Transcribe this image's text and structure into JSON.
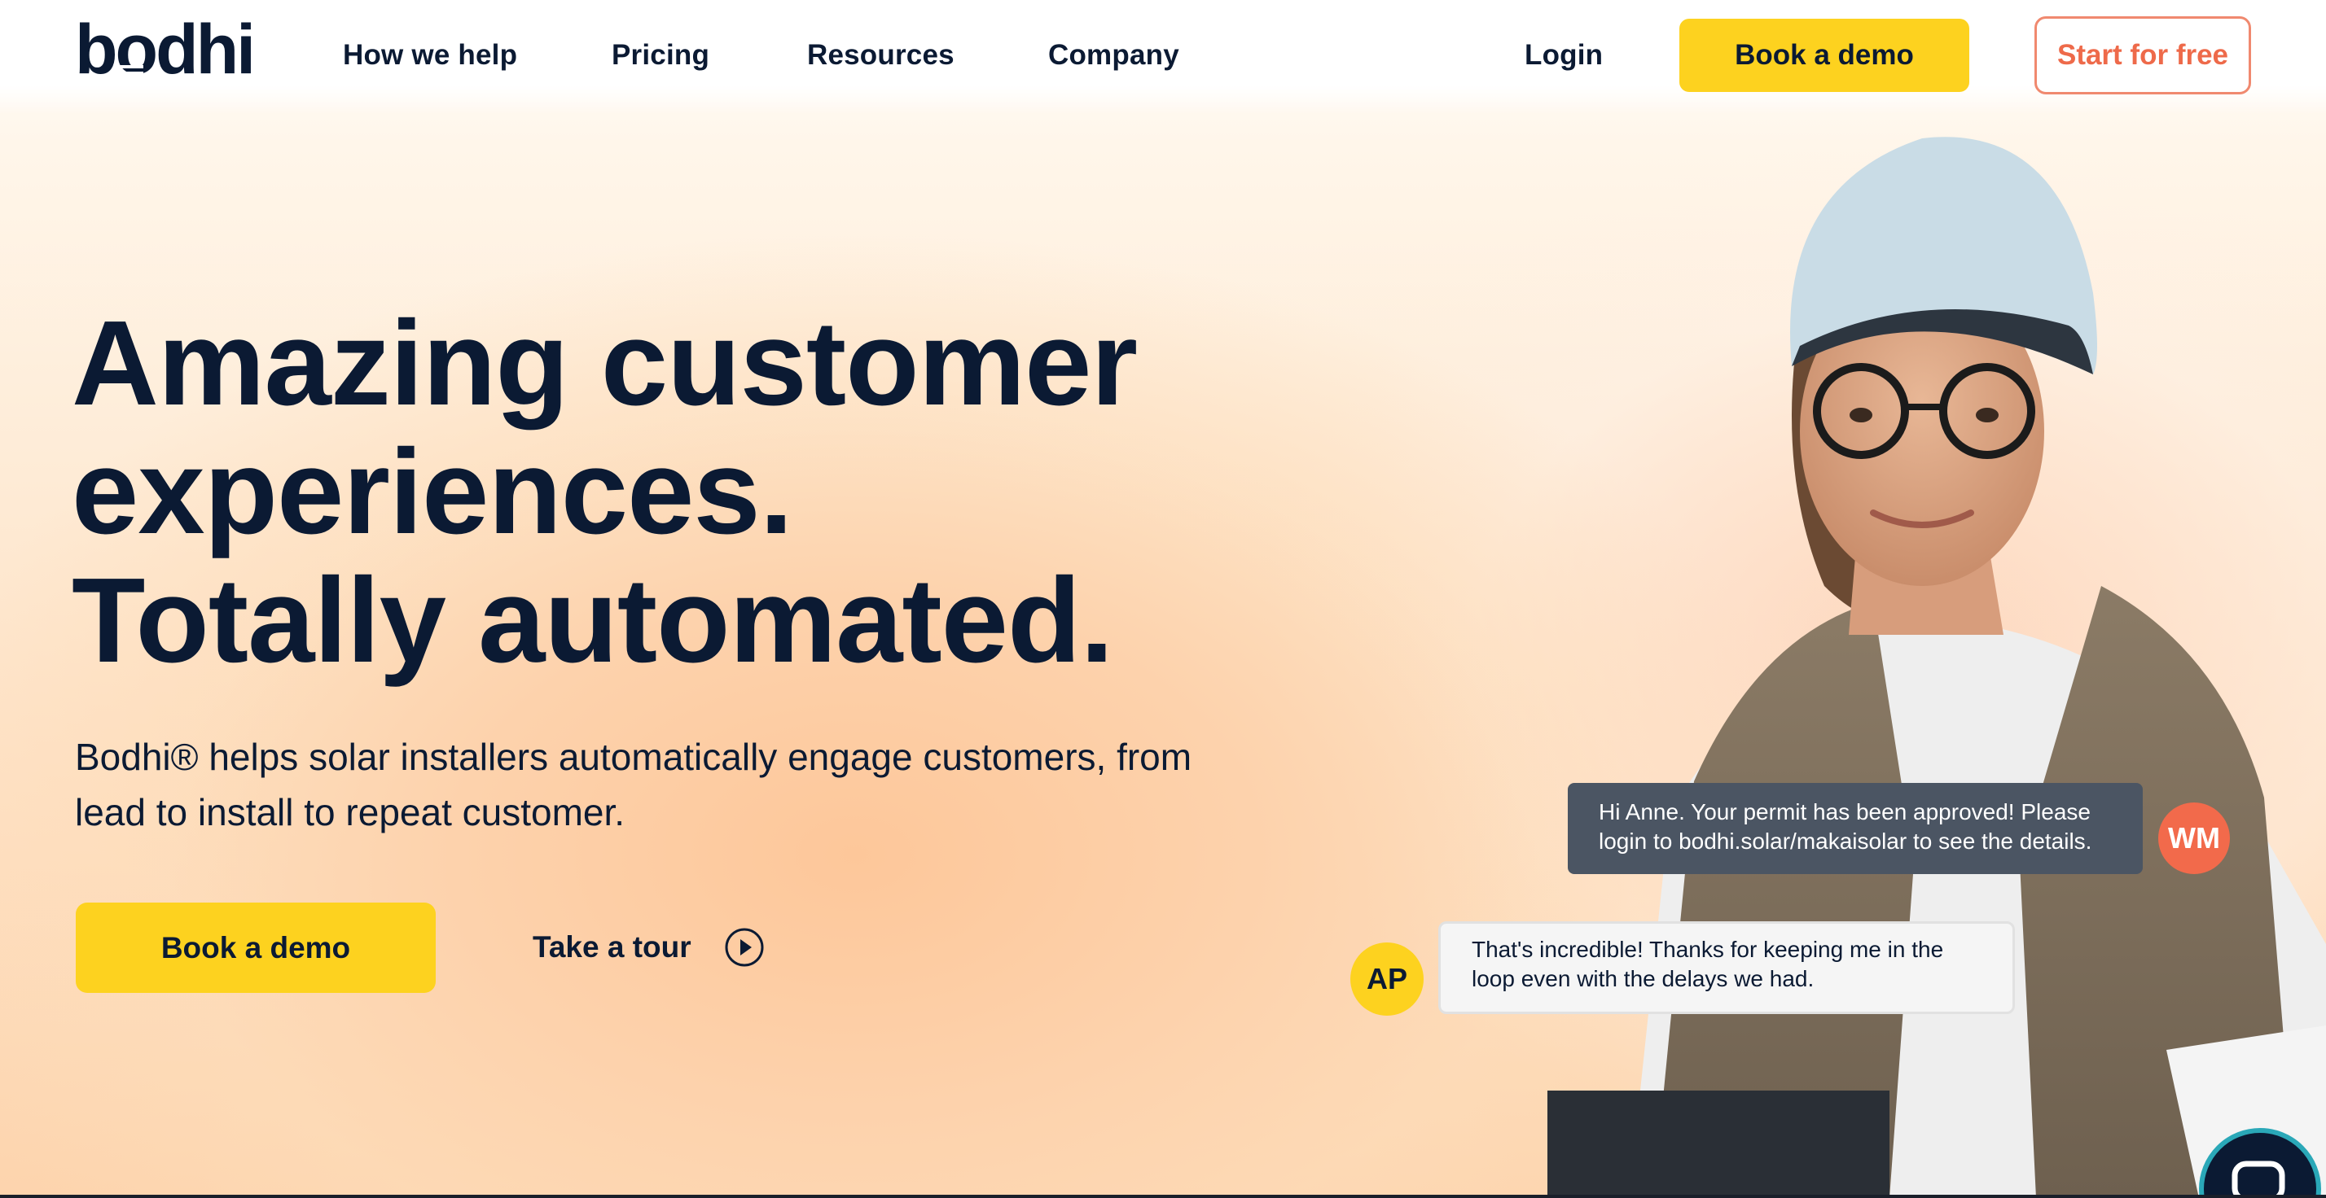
{
  "brand": {
    "logo_text": "bodhi",
    "colors": {
      "navy": "#0b1a33",
      "yellow": "#fdd21f",
      "coral": "#ee6a4a",
      "bubble_dark": "#4b5563"
    }
  },
  "nav": {
    "links": [
      "How we help",
      "Pricing",
      "Resources",
      "Company"
    ],
    "login": "Login",
    "book_demo": "Book a demo",
    "start_free": "Start for free"
  },
  "hero": {
    "headline": [
      "Amazing customer",
      "experiences.",
      "Totally automated."
    ],
    "subtext": "Bodhi® helps solar installers automatically engage customers, from lead to install to repeat customer.",
    "cta_primary": "Book a demo",
    "cta_secondary": "Take a tour",
    "cta_secondary_icon": "play-circle-icon"
  },
  "chat": {
    "message_1": {
      "avatar": "WM",
      "text": "Hi Anne. Your permit has been approved! Please login to bodhi.solar/makaisolar to see the details."
    },
    "message_2": {
      "avatar": "AP",
      "text": "That's incredible! Thanks for keeping me in the loop even with the delays we had."
    },
    "widget_icon": "chat-bubble-icon"
  }
}
